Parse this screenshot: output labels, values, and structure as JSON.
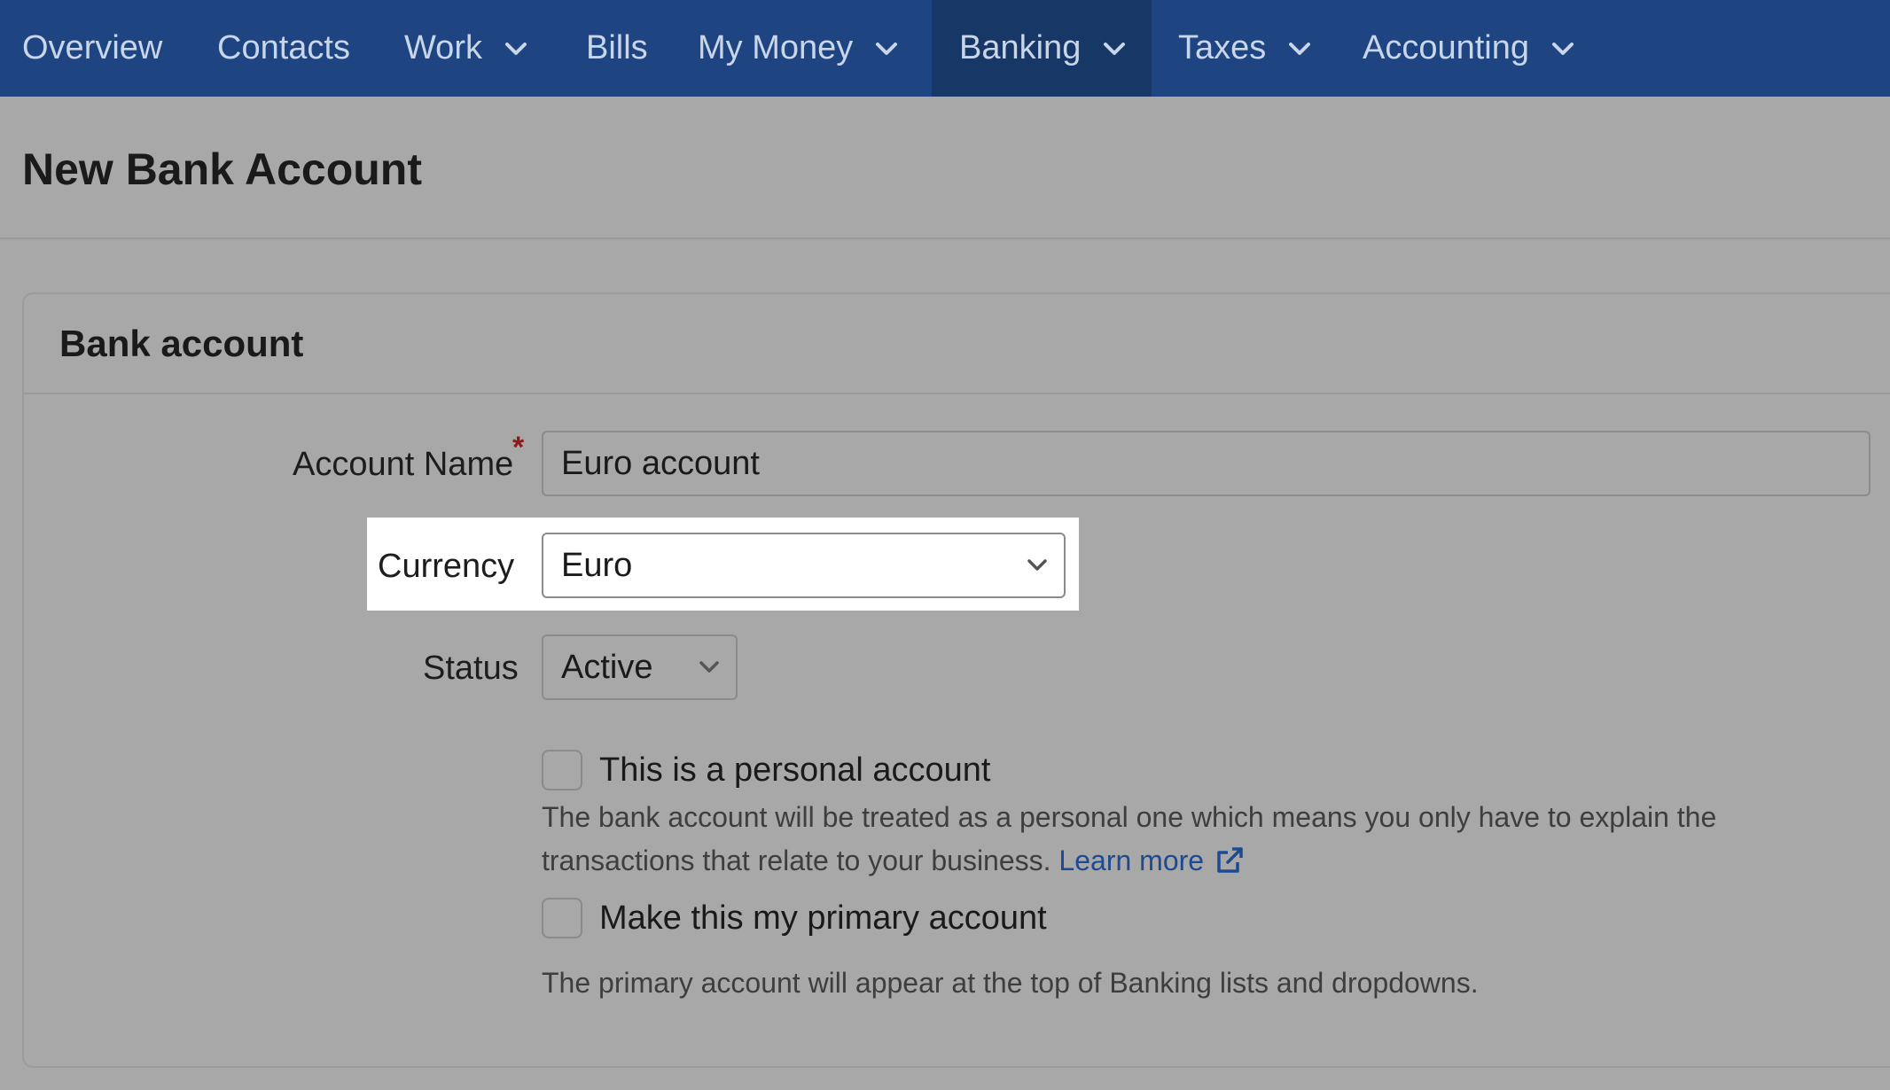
{
  "nav": {
    "items": [
      {
        "label": "Overview"
      },
      {
        "label": "Contacts"
      },
      {
        "label": "Work"
      },
      {
        "label": "Bills"
      },
      {
        "label": "My Money"
      },
      {
        "label": "Banking"
      },
      {
        "label": "Taxes"
      },
      {
        "label": "Accounting"
      }
    ]
  },
  "page": {
    "title": "New Bank Account"
  },
  "card": {
    "title": "Bank account"
  },
  "form": {
    "account_name": {
      "label": "Account Name",
      "required_marker": "*",
      "value": "Euro account"
    },
    "currency": {
      "label": "Currency",
      "selected": "Euro"
    },
    "status": {
      "label": "Status",
      "selected": "Active"
    },
    "personal": {
      "label": "This is a personal account",
      "checked": false,
      "help_text": "The bank account will be treated as a personal one which means you only have to explain the transactions that relate to your business.",
      "learn_more": "Learn more"
    },
    "primary": {
      "label": "Make this my primary account",
      "checked": false,
      "help_text": "The primary account will appear at the top of Banking lists and dropdowns."
    }
  },
  "colors": {
    "nav_bg": "#1e4582",
    "nav_active_bg": "#173766",
    "link": "#1d4a92",
    "required": "#8e1a1a"
  }
}
